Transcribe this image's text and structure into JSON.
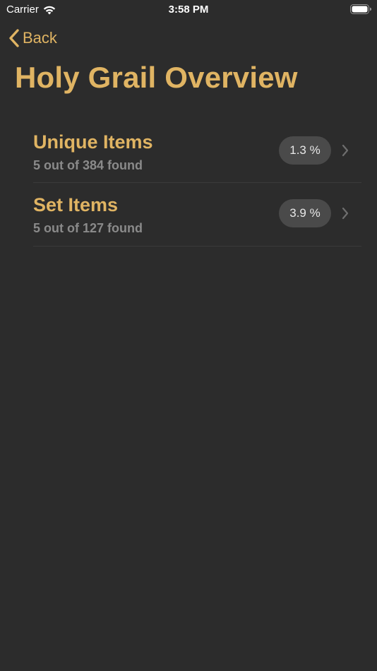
{
  "status_bar": {
    "carrier": "Carrier",
    "time": "3:58 PM",
    "icons": [
      "wifi-icon",
      "battery-icon"
    ]
  },
  "nav": {
    "back_label": "Back",
    "back_icon": "chevron-left-icon",
    "title": "Holy Grail Overview"
  },
  "colors": {
    "background": "#2c2c2c",
    "accent": "#e0b463",
    "subtitle": "#8a8a8a",
    "badge_bg": "#4a4a4a"
  },
  "overview": {
    "items": [
      {
        "title": "Unique Items",
        "subtitle": "5 out of 384 found",
        "percent": "1.3 %",
        "icon": "chevron-right-icon"
      },
      {
        "title": "Set Items",
        "subtitle": "5 out of 127 found",
        "percent": "3.9 %",
        "icon": "chevron-right-icon"
      }
    ]
  }
}
